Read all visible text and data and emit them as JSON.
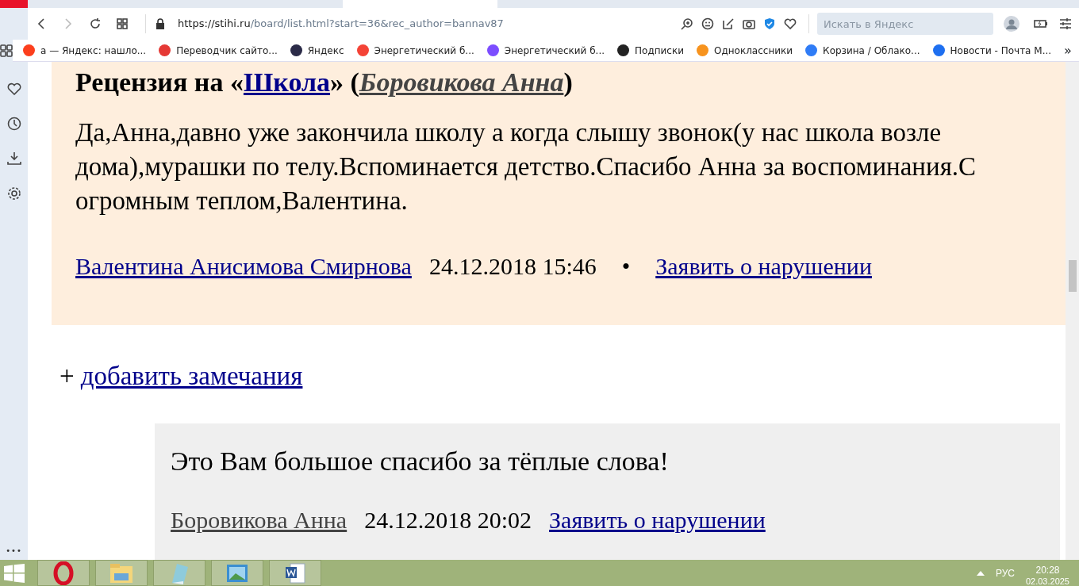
{
  "browser": {
    "url_host": "https://stihi.ru",
    "url_path": "/board/list.html?start=36&rec_author=bannav87",
    "search_placeholder": "Искать в Яндекс",
    "bookmarks": [
      {
        "label": "а — Яндекс: нашло...",
        "color": "#fc3f1d"
      },
      {
        "label": "Переводчик сайто...",
        "color": "#e53935"
      },
      {
        "label": "Яндекс",
        "color": "#2b2b48"
      },
      {
        "label": "Энергетический б...",
        "color": "#f44336"
      },
      {
        "label": "Энергетический б...",
        "color": "#7c4dff"
      },
      {
        "label": "Подписки",
        "color": "#222222"
      },
      {
        "label": "Одноклассники",
        "color": "#f7931e"
      },
      {
        "label": "Корзина / Облако...",
        "color": "#2f7cf6"
      },
      {
        "label": "Новости - Почта М...",
        "color": "#1e6ff0"
      }
    ],
    "more": "»"
  },
  "review": {
    "prefix": "Рецензия на «",
    "work": "Школа",
    "middle": "» (",
    "author": "Боровикова Анна",
    "suffix": ")",
    "text": "Да,Анна,давно уже закончила школу а когда слышу звонок(у нас школа возле дома),мурашки по телу.Вспоминается детство.Спасибо Анна за воспоминания.С огромным теплом,Валентина.",
    "reviewer": "Валентина Анисимова Смирнова",
    "date": "24.12.2018 15:46",
    "bullet": "•",
    "report": "Заявить о нарушении"
  },
  "add_note": {
    "plus": "+",
    "label": "добавить замечания"
  },
  "reply": {
    "text": "Это Вам большое спасибо за тёплые слова!",
    "author": "Боровикова Анна",
    "date": "24.12.2018 20:02",
    "report": "Заявить о нарушении"
  },
  "sidebar": {
    "more": "•••"
  },
  "taskbar": {
    "language": "РУС",
    "time": "20:28",
    "date": "02.03.2025"
  }
}
